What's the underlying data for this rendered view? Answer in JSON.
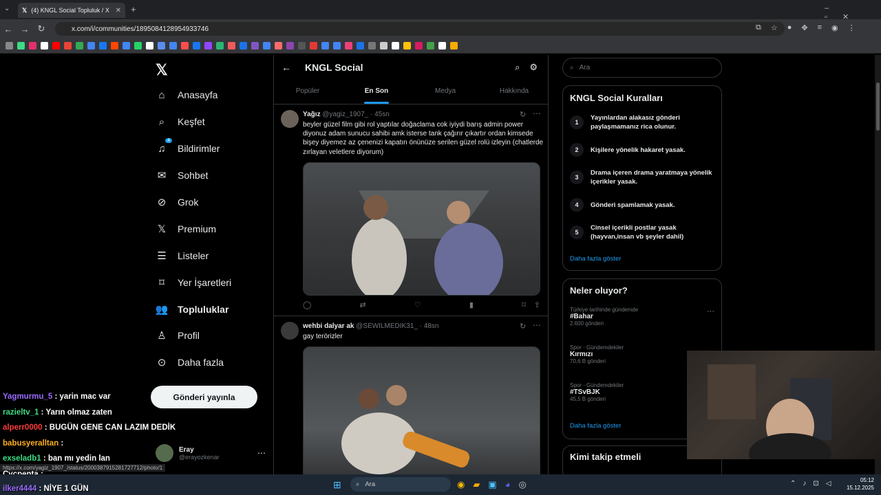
{
  "browser": {
    "tab_title": "(4) KNGL Social Topluluk / X",
    "url": "x.com/i/communities/1895084128954933746",
    "status_url": "https://x.com/yagiz_1907_/status/2000387915281727712/photo/1"
  },
  "nav": {
    "items": [
      {
        "label": "Anasayfa",
        "icon": "home-icon"
      },
      {
        "label": "Keşfet",
        "icon": "search-icon"
      },
      {
        "label": "Bildirimler",
        "icon": "bell-icon",
        "badge": "4"
      },
      {
        "label": "Sohbet",
        "icon": "mail-icon"
      },
      {
        "label": "Grok",
        "icon": "grok-icon"
      },
      {
        "label": "Premium",
        "icon": "x-icon"
      },
      {
        "label": "Listeler",
        "icon": "list-icon"
      },
      {
        "label": "Yer İşaretleri",
        "icon": "bookmark-icon"
      },
      {
        "label": "Topluluklar",
        "icon": "people-icon"
      },
      {
        "label": "Profil",
        "icon": "person-icon"
      },
      {
        "label": "Daha fazla",
        "icon": "more-icon"
      }
    ],
    "post_button": "Gönderi yayınla",
    "account": {
      "name": "Eray",
      "handle": "@erayozkenar"
    }
  },
  "main": {
    "title": "KNGL Social",
    "tabs": [
      "Popüler",
      "En Son",
      "Medya",
      "Hakkında"
    ],
    "active_tab": "En Son",
    "posts": [
      {
        "name": "Yağız",
        "handle": "@yagiz_1907_",
        "time": "· 45sn",
        "text": "beyler güzel film gibi rol yaptılar doğaclama cok iyiydi barış admin power diyonuz adam sunucu sahibi amk isterse tank çağırır çıkartır ordan kimsede bişey diyemez az çenenizi kapatın önünüze serilen güzel rolü izleyin (chatlerde zırlayan veletlere diyorum)"
      },
      {
        "name": "wehbi dalyar ak",
        "handle": "@SEWILMEDIK31_",
        "time": "· 48sn",
        "text": "gay terörizler"
      }
    ]
  },
  "right": {
    "search_placeholder": "Ara",
    "rules_title": "KNGL Social Kuralları",
    "rules": [
      {
        "n": "1",
        "text": "Yayınlardan alakasız gönderi paylaşmamanız rica olunur."
      },
      {
        "n": "2",
        "text": "Kişilere yönelik hakaret yasak."
      },
      {
        "n": "3",
        "text": "Drama içeren drama yaratmaya yönelik içerikler yasak."
      },
      {
        "n": "4",
        "text": "Gönderi spamlamak yasak."
      },
      {
        "n": "5",
        "text": "Cinsel içerikli postlar yasak (hayvan,insan vb şeyler dahil)"
      }
    ],
    "show_more": "Daha fazla göster",
    "trends_title": "Neler oluyor?",
    "trends": [
      {
        "cat": "Türkiye tarihinde gündemde",
        "title": "#Bahar",
        "count": "2.600 gönderi"
      },
      {
        "cat": "Spor · Gündemdekiler",
        "title": "Kırmızı",
        "count": "70,6 B gönderi"
      },
      {
        "cat": "Spor · Gündemdekiler",
        "title": "#TSvBJK",
        "count": "45,5 B gönderi"
      }
    ],
    "trends_more": "Daha fazla göster",
    "follow_title": "Kimi takip etmeli"
  },
  "chat": [
    {
      "user": "Yagmurmu_5",
      "msg": ": yarin mac var",
      "color": "#9b6bff"
    },
    {
      "user": "razieltv_1",
      "msg": ": Yarın olmaz zaten",
      "color": "#3ddc84"
    },
    {
      "user": "alperr0000",
      "msg": ": BUGÜN GENE CAN LAZIM DEDİK",
      "color": "#ff3b3b"
    },
    {
      "user": "babusyeralltan",
      "msg": ":",
      "color": "#ffb020"
    },
    {
      "user": "exseladb1",
      "msg": ": ban mı yedin lan",
      "color": "#3ddc84"
    },
    {
      "user": "Cycpenta",
      "msg": ":",
      "color": "#ffffff"
    },
    {
      "user": "ilker4444",
      "msg": ": NİYE 1 GÜN",
      "color": "#9b6bff"
    }
  ],
  "taskbar": {
    "search": "Ara",
    "time": "05:12",
    "date": "15.12.2025"
  }
}
